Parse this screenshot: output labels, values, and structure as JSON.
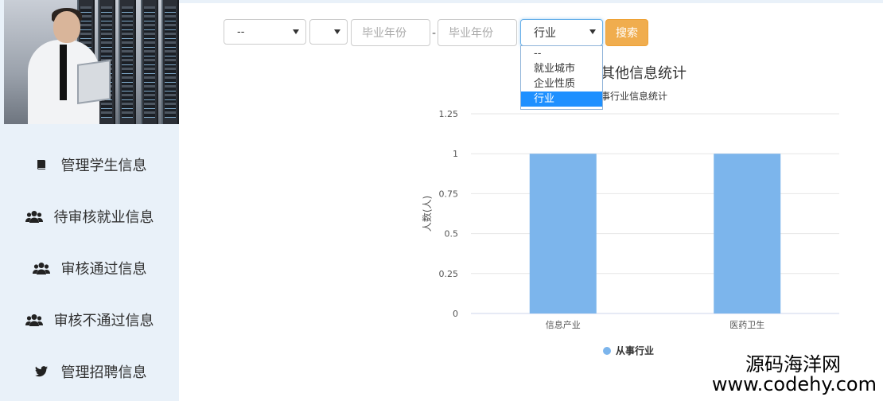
{
  "sidebar": {
    "items": [
      {
        "label": "管理学生信息",
        "icon": "book-icon"
      },
      {
        "label": "待审核就业信息",
        "icon": "users-icon"
      },
      {
        "label": "审核通过信息",
        "icon": "users-icon"
      },
      {
        "label": "审核不通过信息",
        "icon": "users-icon"
      },
      {
        "label": "管理招聘信息",
        "icon": "twitter-icon"
      }
    ]
  },
  "filters": {
    "select1_value": "--",
    "select2_value": "",
    "year_from_placeholder": "毕业年份",
    "range_separator": "-",
    "year_to_placeholder": "毕业年份",
    "type_value": "行业",
    "type_options": [
      "--",
      "就业城市",
      "企业性质",
      "行业"
    ],
    "search_label": "搜索"
  },
  "chart_heading": {
    "title": "其他信息统计",
    "subtitle": "事行业信息统计"
  },
  "chart_data": {
    "type": "bar",
    "categories": [
      "信息产业",
      "医药卫生"
    ],
    "series": [
      {
        "name": "从事行业",
        "values": [
          1,
          1
        ]
      }
    ],
    "ylabel": "人数(人)",
    "xlabel": "",
    "ylim": [
      0,
      1.25
    ],
    "yticks": [
      0,
      0.25,
      0.5,
      0.75,
      1,
      1.25
    ],
    "grid": true,
    "legend": "bottom",
    "bar_color": "#7cb5ec"
  },
  "watermark": {
    "line1": "源码海洋网",
    "line2": "www.codehy.com"
  }
}
